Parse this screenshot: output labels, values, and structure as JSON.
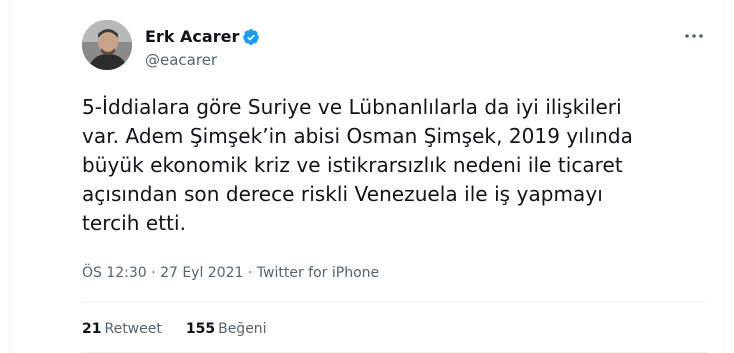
{
  "author": {
    "name": "Erk Acarer",
    "handle": "@eacarer",
    "verified": true
  },
  "tweet": {
    "lines": [
      "5-İddialara göre Suriye ve Lübnanlılarla da iyi ilişkileri",
      "var. Adem Şimşek’in abisi Osman Şimşek, 2019 yılında",
      "büyük ekonomik kriz ve istikrarsızlık nedeni ile ticaret",
      "açısından son derece riskli Venezuela ile iş yapmayı",
      "tercih etti."
    ]
  },
  "meta": {
    "time": "ÖS 12:30",
    "separator": " · ",
    "date": "27 Eyl 2021",
    "source": "Twitter for iPhone"
  },
  "stats": {
    "retweets_count": "21",
    "retweets_label": "Retweet",
    "likes_count": "155",
    "likes_label": "Beğeni"
  },
  "colors": {
    "text": "#0f1419",
    "secondary": "#536471",
    "verified": "#1d9bf0",
    "divider": "#eff3f4"
  },
  "icons": {
    "verified": "verified-badge-icon",
    "more": "more-options-icon"
  }
}
